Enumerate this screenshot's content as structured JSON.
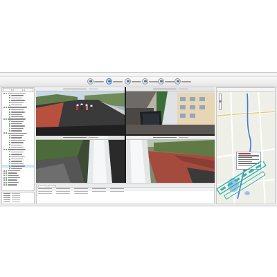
{
  "menu": {
    "items": [
      "",
      "",
      ""
    ]
  },
  "toolbar": {
    "buttons": [
      "",
      "",
      "",
      "",
      "",
      ""
    ],
    "active_index": 1
  },
  "tree": {
    "tab_count": 3,
    "selected_row": 31
  },
  "cameras": [
    "",
    "",
    "",
    ""
  ],
  "alarm": {
    "tab_count": 2
  },
  "map": {},
  "colors": {
    "window": "#eeeeee",
    "toolbar_active": "#3b78c2",
    "tree_online": "#4c8f4c",
    "tree_selected": "#cfe3fa",
    "road": "#3a3a3a",
    "track": "#3e7ad4",
    "lake": "#9ec3e6",
    "watermark": "#2fb4a4",
    "alarm_text": "#c73a3a"
  },
  "icons": {
    "toolbar": [
      "video-monitor-icon",
      "realtime-monitor-icon",
      "track-playback-icon",
      "report-icon",
      "settings-icon",
      "system-icon"
    ]
  }
}
